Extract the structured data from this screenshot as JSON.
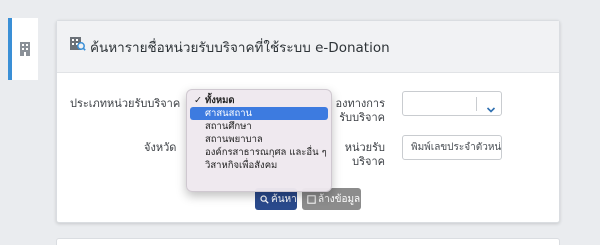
{
  "side_tab": {
    "icon": "building-icon"
  },
  "card": {
    "title": "ค้นหารายชื่อหน่วยรับบริจาคที่ใช้ระบบ e-Donation",
    "title_icon": "search-building-icon"
  },
  "form": {
    "type_label": "ประเภทหน่วยรับบริจาค",
    "province_label": "จังหวัด",
    "method_label_line1": "องทางการ",
    "method_label_line2": "รับบริจาค",
    "unit_label_line1": "หน่วยรับ",
    "unit_label_line2": "บริจาค",
    "method_select_value": "",
    "unit_input_placeholder": "พิมพ์เลขประจำตัวหน่"
  },
  "dropdown": {
    "checked_index": 0,
    "highlighted_index": 1,
    "options": [
      "ทั้งหมด",
      "ศาสนสถาน",
      "สถานศึกษา",
      "สถานพยาบาล",
      "องค์กรสาธารณกุศล และอื่น ๆ",
      "วิสาหกิจเพื่อสังคม"
    ]
  },
  "buttons": {
    "search_label": "ค้นหา",
    "clear_label": "ล้างข้อมูล"
  },
  "colors": {
    "accent": "#3a8fd6",
    "primary_button": "#2a4a8c",
    "secondary_button": "#8c8c8c",
    "highlight": "#3d7be0"
  }
}
